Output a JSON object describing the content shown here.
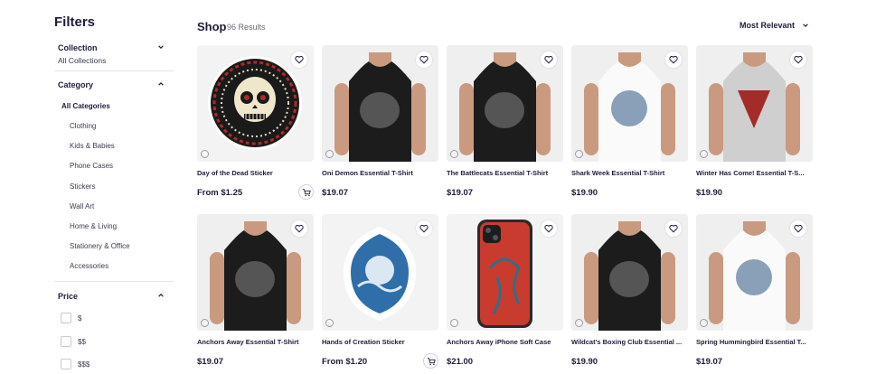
{
  "sidebar": {
    "title": "Filters",
    "collection": {
      "heading": "Collection",
      "value": "All Collections"
    },
    "category": {
      "heading": "Category",
      "items": [
        "All Categories",
        "Clothing",
        "Kids & Babies",
        "Phone Cases",
        "Stickers",
        "Wall Art",
        "Home & Living",
        "Stationery & Office",
        "Accessories"
      ]
    },
    "price": {
      "heading": "Price",
      "options": [
        "$",
        "$$",
        "$$$"
      ]
    }
  },
  "header": {
    "title": "Shop",
    "count": "96 Results",
    "sort_label": "Most Relevant"
  },
  "products": [
    {
      "title": "Day of the Dead Sticker",
      "price": "From $1.25",
      "art": "sugar-skull-sticker"
    },
    {
      "title": "Oni Demon Essential T-Shirt",
      "price": "$19.07",
      "art": "black-tshirt"
    },
    {
      "title": "The Battlecats Essential T-Shirt",
      "price": "$19.07",
      "art": "black-tshirt"
    },
    {
      "title": "Shark Week Essential T-Shirt",
      "price": "$19.90",
      "art": "white-tshirt"
    },
    {
      "title": "Winter Has Come! Essential T-S...",
      "price": "$19.90",
      "art": "grey-tshirt"
    },
    {
      "title": "Anchors Away Essential T-Shirt",
      "price": "$19.07",
      "art": "black-tshirt"
    },
    {
      "title": "Hands of Creation Sticker",
      "price": "From $1.20",
      "art": "wave-sticker"
    },
    {
      "title": "Anchors Away iPhone Soft Case",
      "price": "$21.00",
      "art": "phone-case"
    },
    {
      "title": "Wildcat's Boxing Club Essential ...",
      "price": "$19.90",
      "art": "black-tshirt"
    },
    {
      "title": "Spring Hummingbird Essential T...",
      "price": "$19.07",
      "art": "white-tshirt"
    }
  ],
  "colors": {
    "accent": "#1d1d3a",
    "muted": "#6b6b7b",
    "border": "#e5e5ea"
  }
}
